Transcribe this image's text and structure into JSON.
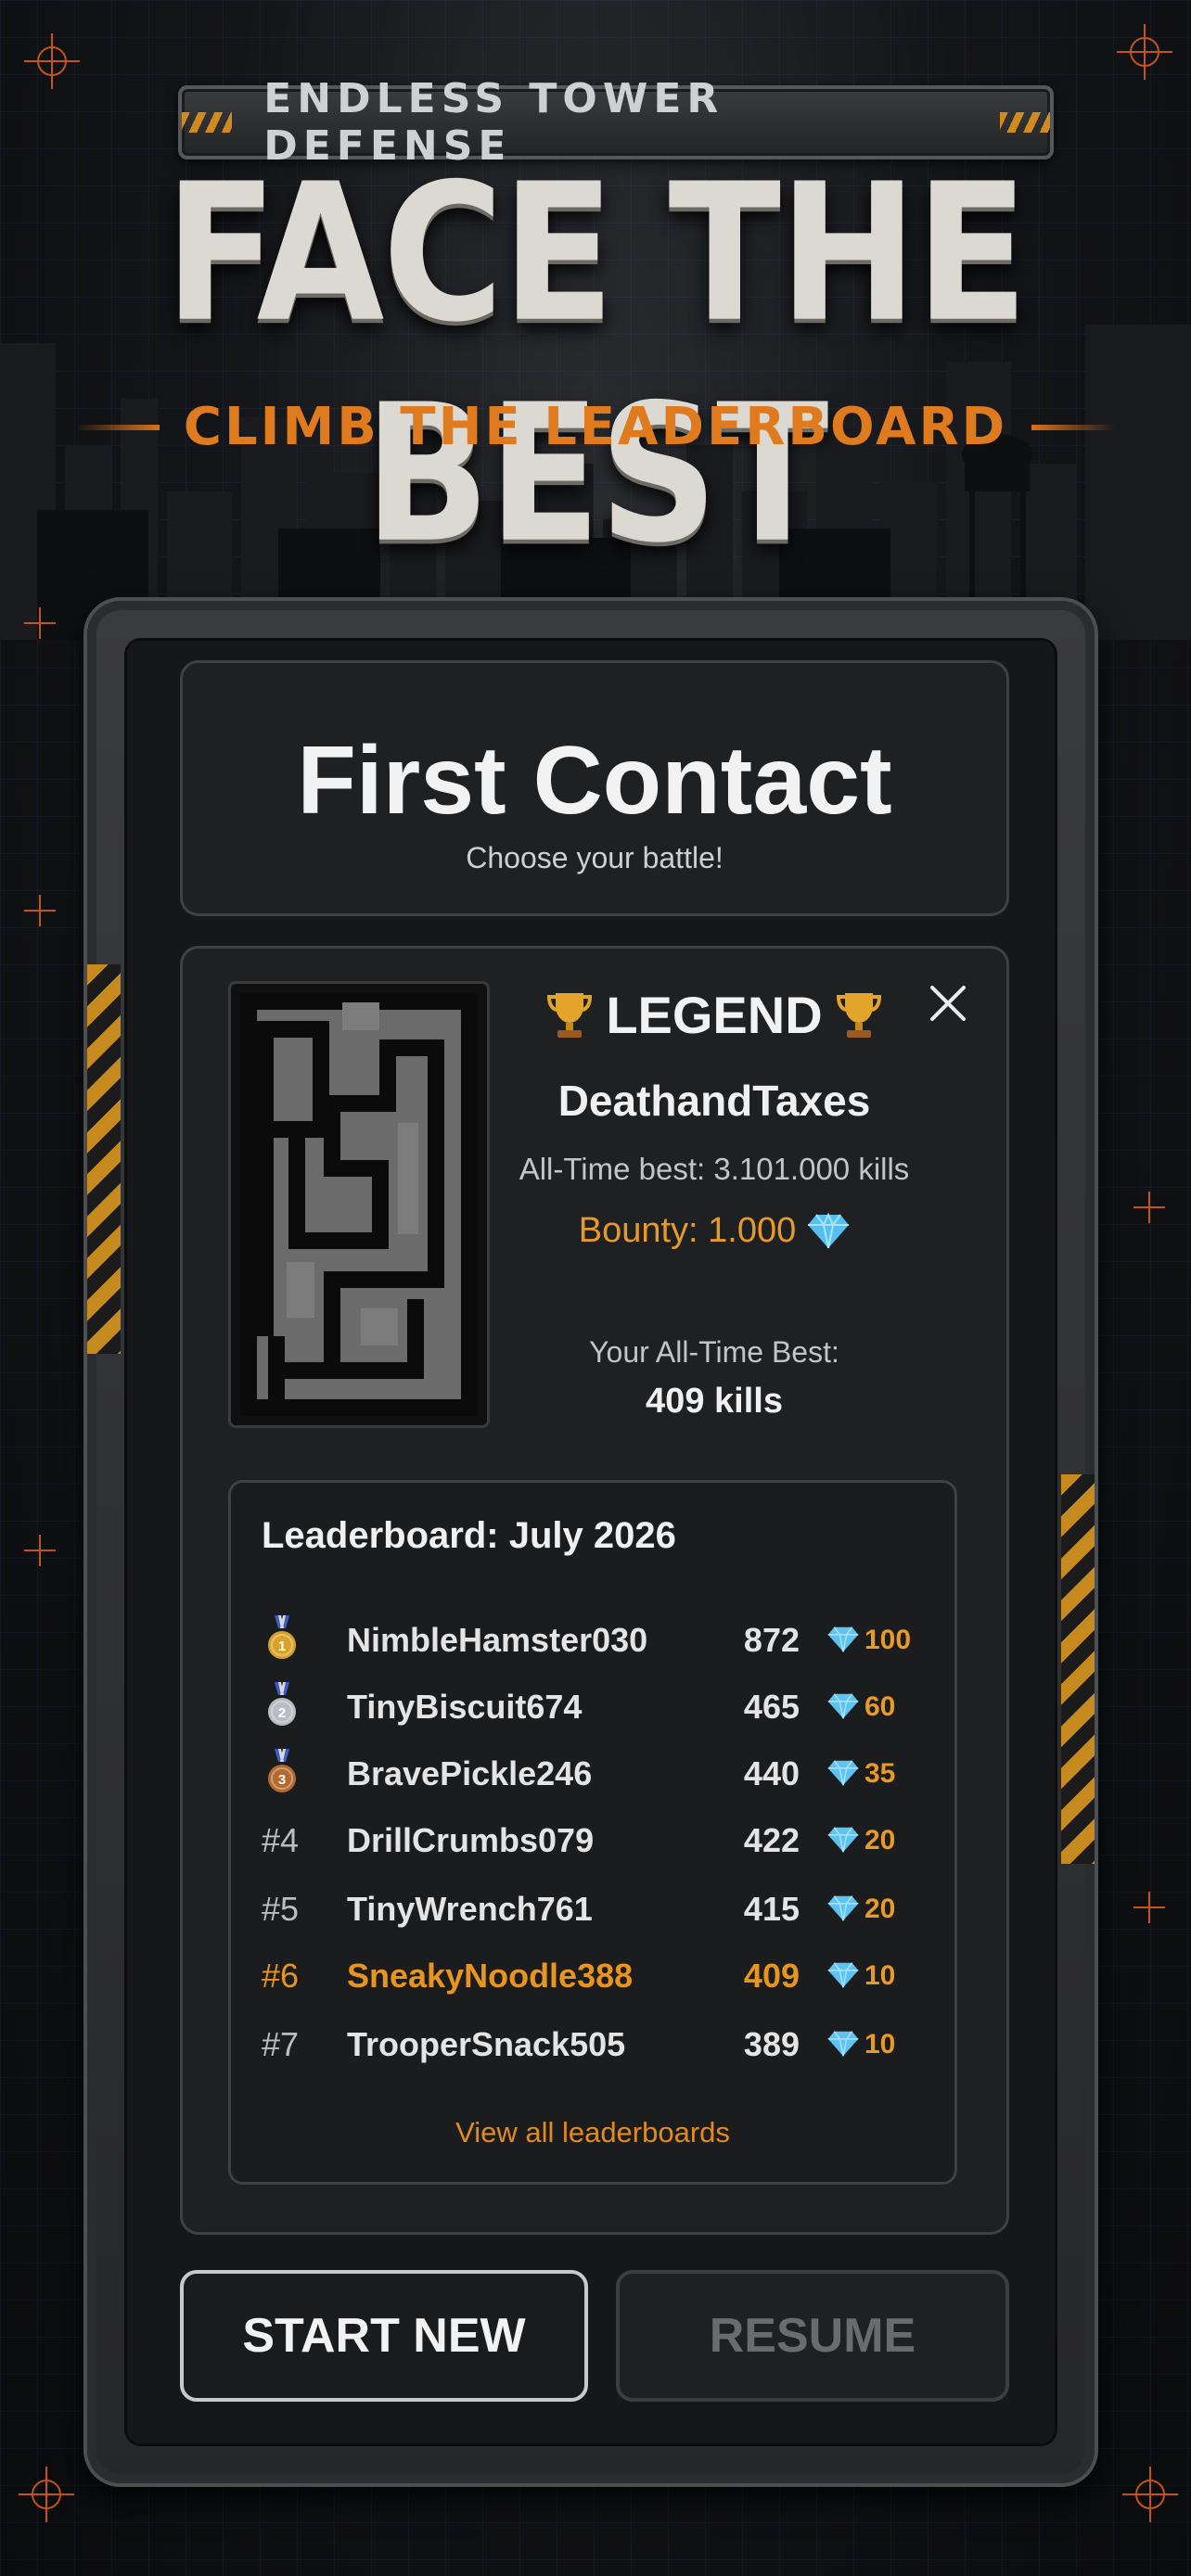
{
  "header": {
    "tag": "ENDLESS TOWER DEFENSE",
    "headline": "FACE THE BEST",
    "subline": "CLIMB THE LEADERBOARD"
  },
  "level": {
    "title": "First Contact",
    "subtitle": "Choose your battle!"
  },
  "legend": {
    "label": "LEGEND",
    "name": "DeathandTaxes",
    "all_time_best": "All-Time best: 3.101.000 kills",
    "bounty": "Bounty: 1.000",
    "your_best_label": "Your All-Time Best:",
    "your_best_value": "409 kills"
  },
  "leaderboard": {
    "title": "Leaderboard:  July 2026",
    "rows": [
      {
        "rank": "1",
        "medal": "gold",
        "name": "NimbleHamster030",
        "score": "872",
        "reward": "100"
      },
      {
        "rank": "2",
        "medal": "silver",
        "name": "TinyBiscuit674",
        "score": "465",
        "reward": "60"
      },
      {
        "rank": "3",
        "medal": "bronze",
        "name": "BravePickle246",
        "score": "440",
        "reward": "35"
      },
      {
        "rank": "#4",
        "name": "DrillCrumbs079",
        "score": "422",
        "reward": "20"
      },
      {
        "rank": "#5",
        "name": "TinyWrench761",
        "score": "415",
        "reward": "20"
      },
      {
        "rank": "#6",
        "name": "SneakyNoodle388",
        "score": "409",
        "reward": "10",
        "is_player": true
      },
      {
        "rank": "#7",
        "name": "TrooperSnack505",
        "score": "389",
        "reward": "10"
      }
    ],
    "view_all": "View all leaderboards"
  },
  "buttons": {
    "start_new": "START NEW",
    "resume": "RESUME"
  },
  "colors": {
    "accent_orange": "#e8951f",
    "gem_blue": "#5fc3f2",
    "medal_gold": "#d9a32a",
    "medal_silver": "#b9bcc2",
    "medal_bronze": "#b26a2f"
  },
  "icons": {
    "trophy": "trophy-icon",
    "close": "close-icon",
    "gem": "diamond-icon",
    "medal": "medal-icon"
  }
}
